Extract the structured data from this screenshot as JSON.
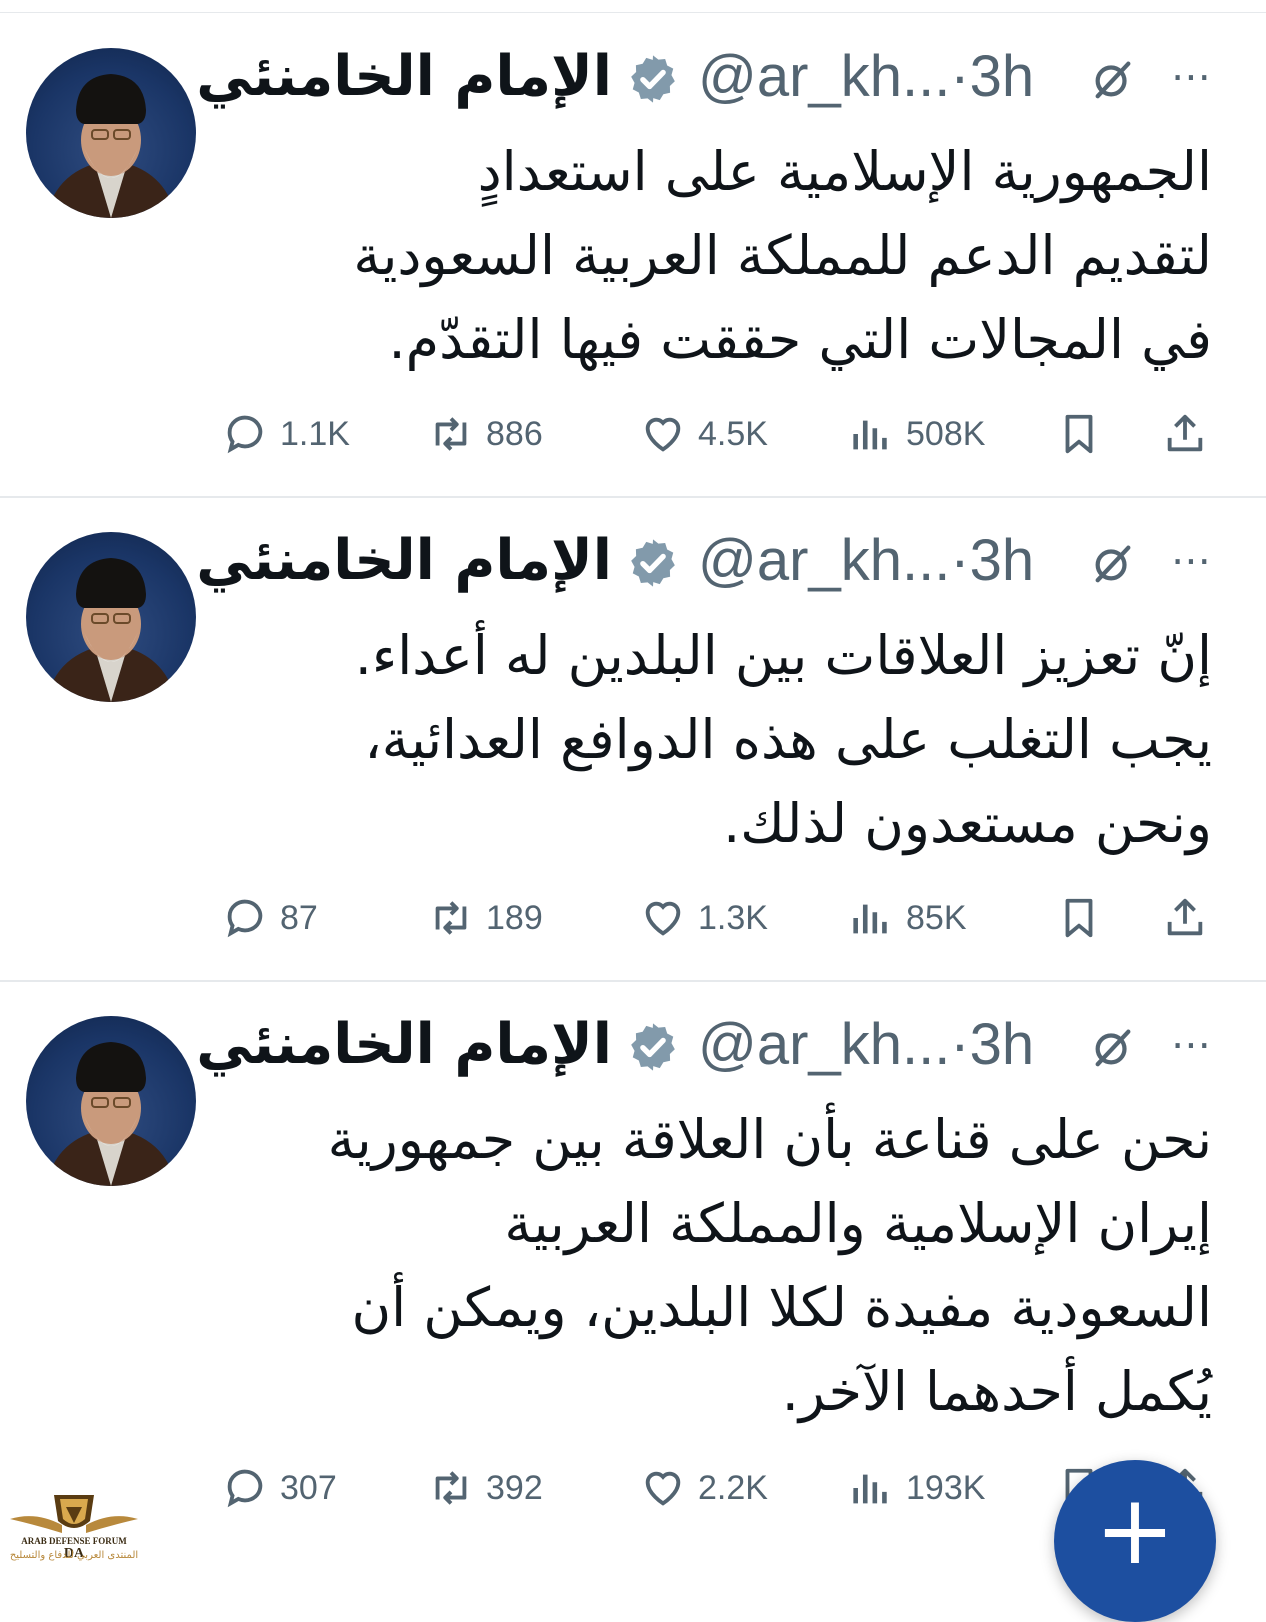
{
  "tweets": [
    {
      "author": "الإمام الخامنئي",
      "handle": "@ar_kh...·3h",
      "body": [
        "الجمهورية الإسلامية على استعدادٍ",
        "لتقديم الدعم للمملكة العربية السعودية",
        "في المجالات التي حققت فيها التقدّم."
      ],
      "replies": "1.1K",
      "reposts": "886",
      "likes": "4.5K",
      "views": "508K"
    },
    {
      "author": "الإمام الخامنئي",
      "handle": "@ar_kh...·3h",
      "body": [
        "إنّ تعزيز العلاقات بين البلدين له أعداء.",
        "يجب التغلب على هذه الدوافع العدائية،",
        "ونحن مستعدون لذلك."
      ],
      "replies": "87",
      "reposts": "189",
      "likes": "1.3K",
      "views": "85K"
    },
    {
      "author": "الإمام الخامنئي",
      "handle": "@ar_kh...·3h",
      "body": [
        "نحن على قناعة بأن العلاقة بين جمهورية",
        "إيران الإسلامية والمملكة العربية",
        "السعودية مفيدة لكلا البلدين، ويمكن أن",
        "يُكمل أحدهما الآخر."
      ],
      "replies": "307",
      "reposts": "392",
      "likes": "2.2K",
      "views": "193K"
    }
  ],
  "more_icon": "⋯",
  "fab_label": "+",
  "watermark": {
    "en": "ARAB DEFENSE FORUM",
    "ar": "المنتدى العربي للدفاع والتسليح",
    "logo_text": "DA"
  },
  "colors": {
    "text": "#0f1419",
    "muted": "#536471",
    "verified": "#829aab",
    "fab": "#1d4fa0",
    "divider": "#e6e9ec"
  }
}
